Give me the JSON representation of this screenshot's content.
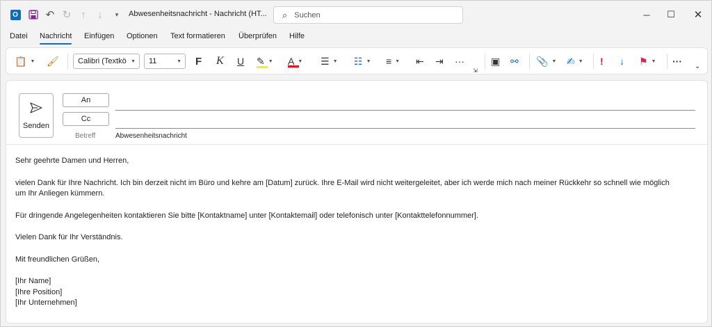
{
  "titlebar": {
    "window_title": "Abwesenheitsnachricht  -  Nachricht (HT...",
    "search_placeholder": "Suchen",
    "icons": [
      "outlook-logo",
      "save-icon",
      "undo-icon",
      "redo-icon",
      "up-icon",
      "down-icon",
      "quick-access-icon"
    ]
  },
  "menu": {
    "items": [
      "Datei",
      "Nachricht",
      "Einfügen",
      "Optionen",
      "Text formatieren",
      "Überprüfen",
      "Hilfe"
    ],
    "active": "Nachricht"
  },
  "ribbon": {
    "font_name": "Calibri (Textkö",
    "font_size": "11",
    "colors": {
      "highlight": "#ffef00",
      "font_color": "#e81123",
      "importance_high": "#e81123",
      "importance_low": "#0f6cbd"
    }
  },
  "compose": {
    "send_label": "Senden",
    "to_label": "An",
    "cc_label": "Cc",
    "subject_label": "Betreff",
    "subject_value": "Abwesenheitsnachricht",
    "body": {
      "greeting": "Sehr geehrte Damen und Herren,",
      "para1_line1": "vielen Dank für Ihre Nachricht. Ich bin derzeit nicht im Büro und kehre am [Datum] zurück. Ihre E-Mail wird nicht weitergeleitet, aber ich werde mich nach meiner Rückkehr so schnell wie möglich",
      "para1_line2": "um Ihr Anliegen kümmern.",
      "para2": "Für dringende Angelegenheiten kontaktieren Sie bitte [Kontaktname] unter [Kontaktemail] oder telefonisch unter [Kontakttelefonnummer].",
      "para3": "Vielen Dank für Ihr Verständnis.",
      "closing": "Mit freundlichen Grüßen,",
      "sig_name": "[Ihr Name]",
      "sig_position": "[Ihre Position]",
      "sig_company": "[Ihr Unternehmen]"
    }
  }
}
